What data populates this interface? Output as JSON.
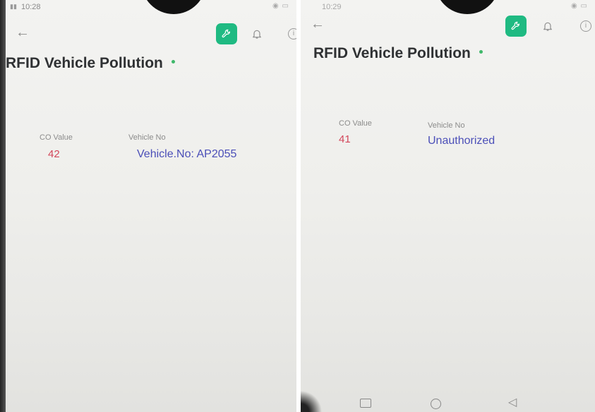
{
  "screens": [
    {
      "status_time": "10:28",
      "app_title": "RFID Vehicle Pollution",
      "co_label": "CO Value",
      "co_value": "42",
      "vehicle_label": "Vehicle No",
      "vehicle_value": "Vehicle.No: AP2055"
    },
    {
      "status_time": "10:29",
      "app_title": "RFID Vehicle Pollution",
      "co_label": "CO Value",
      "co_value": "41",
      "vehicle_label": "Vehicle No",
      "vehicle_value": "Unauthorized"
    }
  ],
  "icons": {
    "back": "back-arrow-icon",
    "tool": "wrench-icon",
    "notifications": "bell-icon",
    "info": "info-icon"
  },
  "colors": {
    "accent": "#1fba82",
    "co_value": "#d3475a",
    "vehicle_value": "#4b4fb8",
    "online_dot": "#3fb86a"
  }
}
